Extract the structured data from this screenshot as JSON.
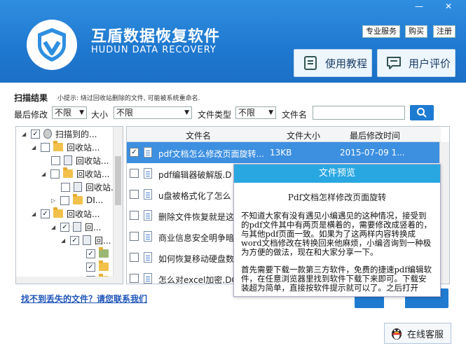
{
  "app": {
    "title_cn": "互盾数据恢复软件",
    "title_en": "HUDUN DATA RECOVERY"
  },
  "window_controls": {
    "minimize": "—",
    "close": "✕"
  },
  "top_links": [
    "专业服务",
    "购买",
    "注册"
  ],
  "header_buttons": {
    "tutorial": "使用教程",
    "review": "用户评价"
  },
  "scan": {
    "title": "扫描结果",
    "tip": "小提示: 绕过回收站删除的文件, 可能被系统重命名."
  },
  "filters": {
    "modified_label": "最后修改",
    "modified_value": "不限",
    "size_label": "大小",
    "size_value": "不限",
    "type_label": "文件类型",
    "type_value": "不限",
    "name_label": "文件名",
    "name_value": ""
  },
  "tree": [
    {
      "label": "扫描到的...",
      "checked": true
    },
    {
      "label": "回收站...",
      "checked": false
    },
    {
      "label": "回收站...",
      "checked": false
    },
    {
      "label": "回收站...",
      "checked": false
    },
    {
      "label": "回收站...",
      "checked": false
    },
    {
      "label": "DI...",
      "checked": false
    },
    {
      "label": "回收站...",
      "checked": true
    },
    {
      "label": "回...",
      "checked": true
    },
    {
      "label": "回...",
      "checked": true
    },
    {
      "label": "",
      "checked": true
    },
    {
      "label": "",
      "checked": true
    },
    {
      "label": "",
      "checked": true
    }
  ],
  "list": {
    "headers": {
      "name": "文件名",
      "size": "文件大小",
      "date": "最后修改时间"
    },
    "rows": [
      {
        "name": "pdf文档怎么修改页面旋转...",
        "size": "13KB",
        "date": "2015-07-09 1...",
        "checked": true
      },
      {
        "name": "pdf编辑器破解版.D",
        "size": "",
        "date": "",
        "checked": false
      },
      {
        "name": "u盘被格式化了怎么",
        "size": "",
        "date": "",
        "checked": false
      },
      {
        "name": "删除文件恢复就是这",
        "size": "",
        "date": "",
        "checked": false
      },
      {
        "name": "商业信息安全明争暗",
        "size": "",
        "date": "",
        "checked": false
      },
      {
        "name": "如何恢复移动硬盘数",
        "size": "",
        "date": "",
        "checked": false
      },
      {
        "name": "怎么对excel加密.DO",
        "size": "",
        "date": "",
        "checked": false
      }
    ]
  },
  "preview": {
    "title": "文件预览",
    "heading": "Pdf文档怎样修改页面旋转",
    "p1": "不知道大家有没有遇见小编遇见的这种情况，接受到的pdf文件其中有两页是横着的，需要修改成竖着的，与其他pdf页面一致。如果为了这两样内容转换成word文档修改在转换回来他麻烦，小编咨询到一种极为方便的做法，现在和大家分享一下。",
    "p2": "首先需要下载一款第三方软件，免费的捷速pdf编辑软件，在任意浏览器里找到软件下载下来即可。下载安装超为简单，直接按软件提示就可以了。之后打开"
  },
  "help_link": "找不到丢失的文件？请您联系我们",
  "online_service": "在线客服"
}
